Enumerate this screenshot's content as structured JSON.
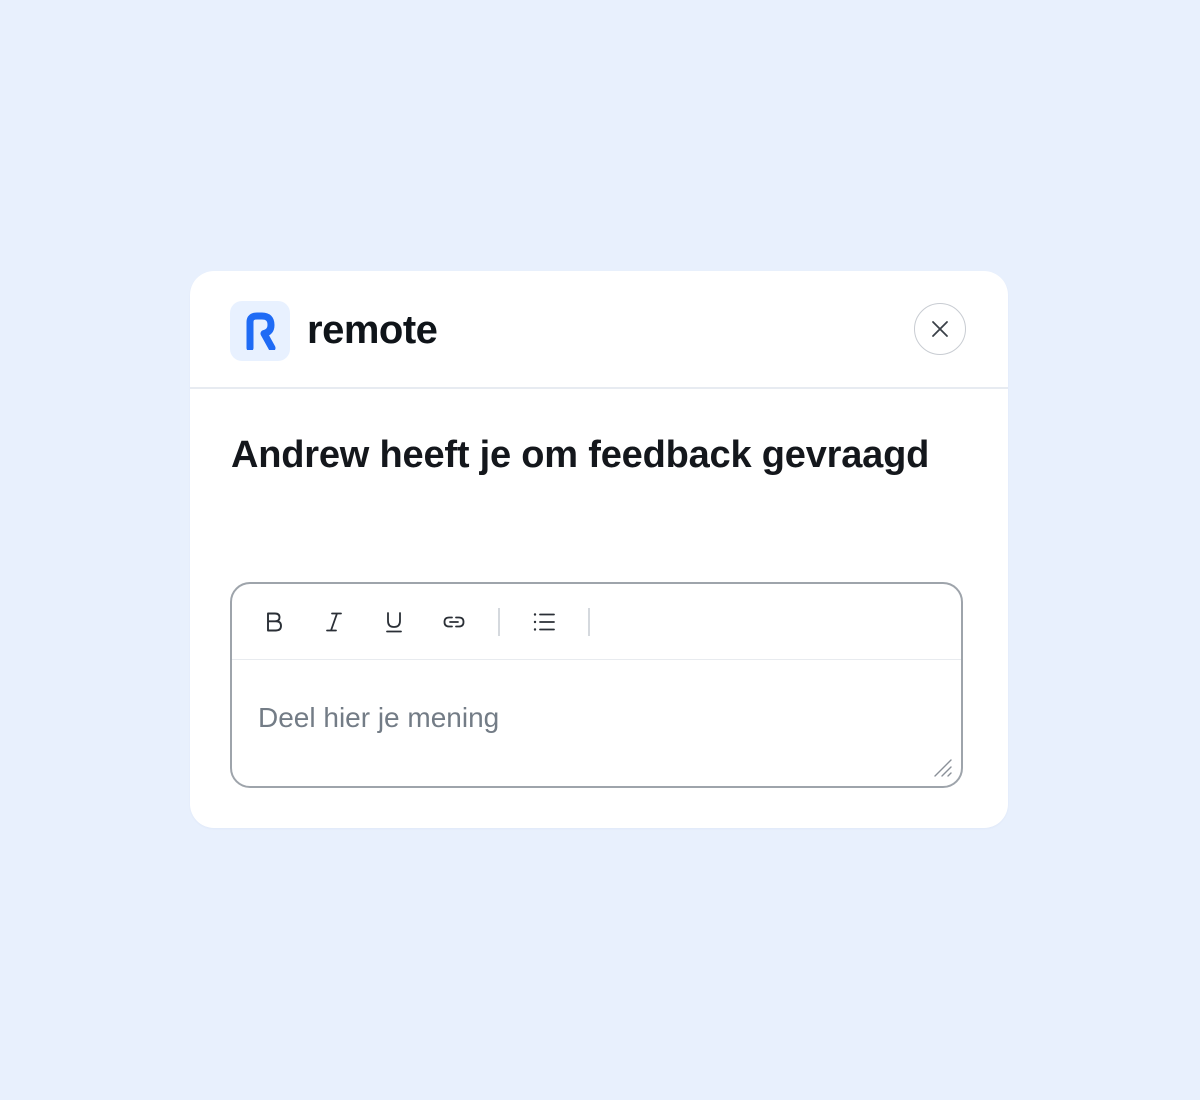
{
  "brand": {
    "name": "remote",
    "accent_color": "#1f6bf5",
    "logo_tile_color": "#e8f1ff"
  },
  "dialog": {
    "title": "Andrew heeft je om feedback gevraagd",
    "close_icon": "close-icon"
  },
  "editor": {
    "toolbar": {
      "tools": [
        "bold-icon",
        "italic-icon",
        "underline-icon",
        "link-icon",
        "bulleted-list-icon"
      ]
    },
    "value": "",
    "placeholder": "Deel hier je mening"
  },
  "colors": {
    "page_background": "#e8f0fd",
    "card_background": "#ffffff",
    "text_primary": "#14171c",
    "placeholder_text": "#737c86",
    "border": "#9ea4ab"
  }
}
